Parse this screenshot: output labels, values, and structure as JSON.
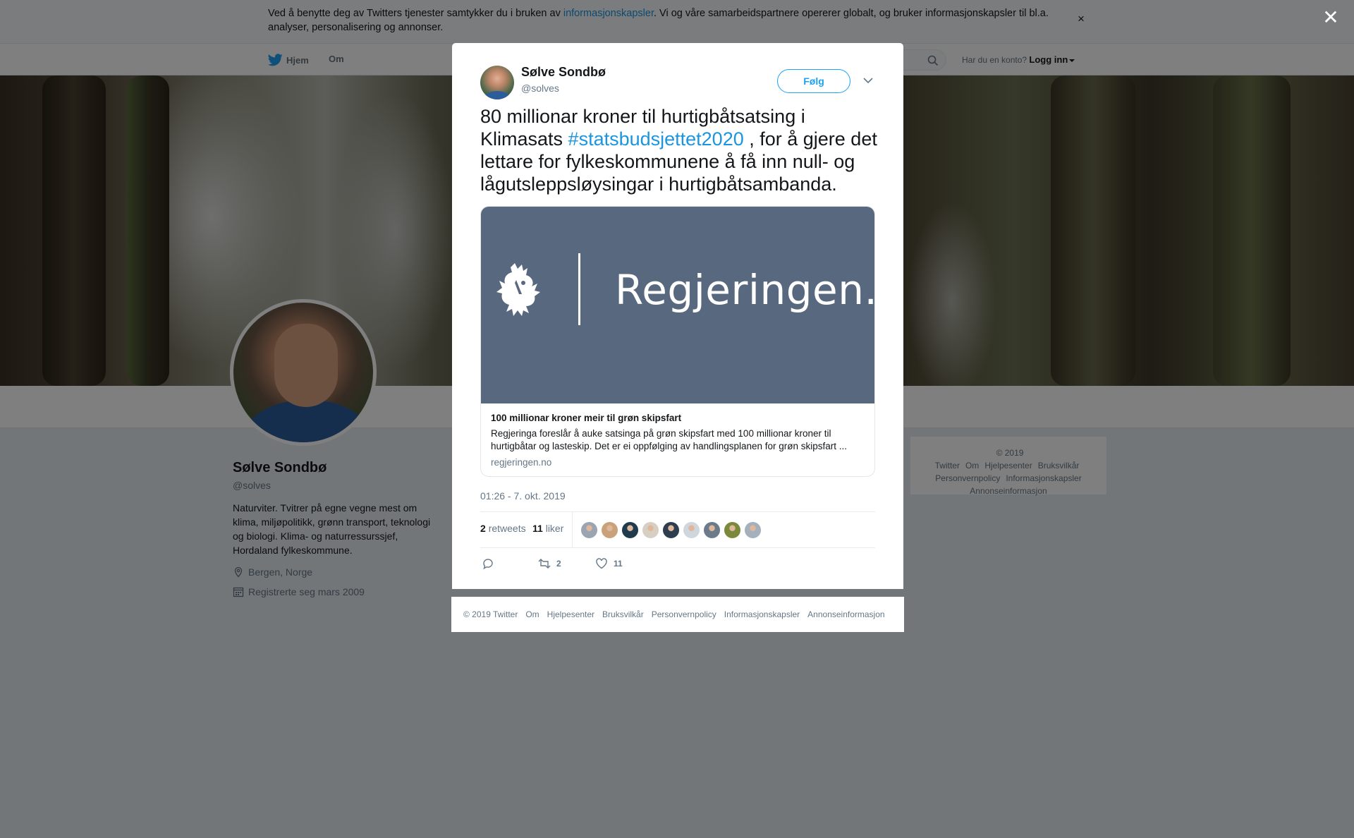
{
  "cookie_bar": {
    "text_before": "Ved å benytte deg av Twitters tjenester samtykker du i bruken av ",
    "link": "informasjonskapsler",
    "text_after": ". Vi og våre samarbeidspartnere opererer globalt, og bruker informasjonskapsler til bl.a. analyser, personalisering og annonser.",
    "close_glyph": "×"
  },
  "nav": {
    "home": "Hjem",
    "about": "Om",
    "account_prompt": "Har du en konto?",
    "login": "Logg inn"
  },
  "profile": {
    "name": "Sølve Sondbø",
    "handle": "@solves",
    "bio": "Naturviter. Tvitrer på egne vegne mest om klima, miljøpolitikk, grønn transport, teknologi og biologi. Klima- og naturressurssjef, Hordaland fylkeskommune.",
    "location": "Bergen, Norge",
    "joined": "Registrerte seg mars 2009"
  },
  "side_footer": {
    "items": [
      "© 2019 Twitter",
      "Om",
      "Hjelpesenter",
      "Bruksvilkår",
      "Personvernpolicy",
      "Informasjonskapsler",
      "Annonseinformasjon"
    ]
  },
  "overlay_close_glyph": "✕",
  "tweet": {
    "author_name": "Sølve Sondbø",
    "author_handle": "@solves",
    "follow_label": "Følg",
    "text_before": "80 millionar kroner til hurtigbåtsatsing i Klimasats ",
    "hashtag": "#statsbudsjettet2020",
    "text_after": " , for å gjere det lettare for  fylkeskommunene å få inn null- og lågutsleppsløysingar i hurtigbåtsambanda.",
    "card": {
      "logo_text": "Regjeringen.no",
      "title": "100 millionar kroner meir til grøn skipsfart",
      "description": "Regjeringa foreslår å auke satsinga på grøn skipsfart med 100 millionar kroner til hurtigbåtar og lasteskip. Det er ei oppfølging av handlingsplanen for grøn skipsfart ...",
      "domain": "regjeringen.no"
    },
    "timestamp": "01:26 - 7. okt. 2019",
    "retweets_count": "2",
    "retweets_label": "retweets",
    "likes_count": "11",
    "likes_label": "liker",
    "reply_count": "",
    "retweet_action_count": "2",
    "like_action_count": "11",
    "liker_colors": [
      "#9aa5b1",
      "#c9a27a",
      "#1f3b4d",
      "#d8cfc4",
      "#2c3e50",
      "#cfd6dc",
      "#6b7b8c",
      "#7a8a3a",
      "#a4b0bc"
    ]
  },
  "modal_footer": {
    "items": [
      "© 2019 Twitter",
      "Om",
      "Hjelpesenter",
      "Bruksvilkår",
      "Personvernpolicy",
      "Informasjonskapsler",
      "Annonseinformasjon"
    ]
  },
  "colors": {
    "accent": "#1da1f2",
    "link": "#1b95e0",
    "card_bg": "#58697f"
  }
}
